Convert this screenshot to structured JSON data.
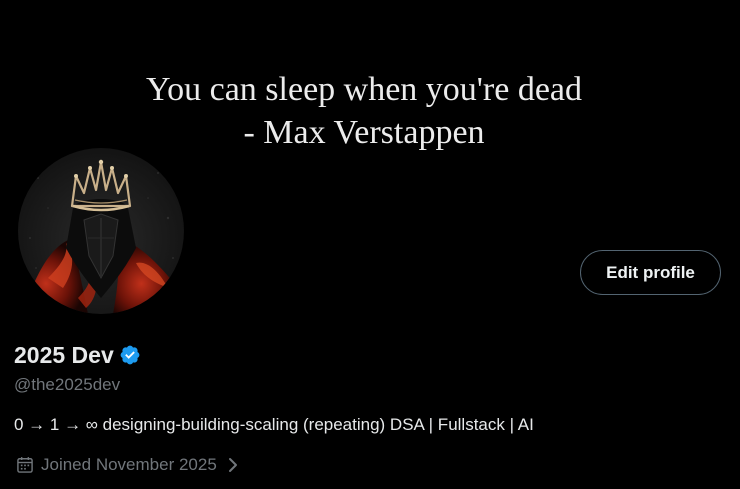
{
  "banner": {
    "quote_line1": "You can sleep when you're dead",
    "quote_line2": "- Max Verstappen"
  },
  "profile": {
    "avatar_icon": "crowned-knight-avatar",
    "edit_button_label": "Edit profile",
    "display_name": "2025 Dev",
    "verified_icon": "verified-badge-icon",
    "verified_color": "#1d9bf0",
    "handle": "@the2025dev",
    "bio": "0 → 1 → ∞ designing-building-scaling (repeating) DSA | Fullstack | AI",
    "joined_icon": "calendar-icon",
    "joined_text": "Joined November 2025",
    "joined_chevron_icon": "chevron-right-icon"
  },
  "colors": {
    "background": "#000000",
    "text_primary": "#e7e9ea",
    "text_secondary": "#71767b",
    "button_border": "#536471"
  }
}
